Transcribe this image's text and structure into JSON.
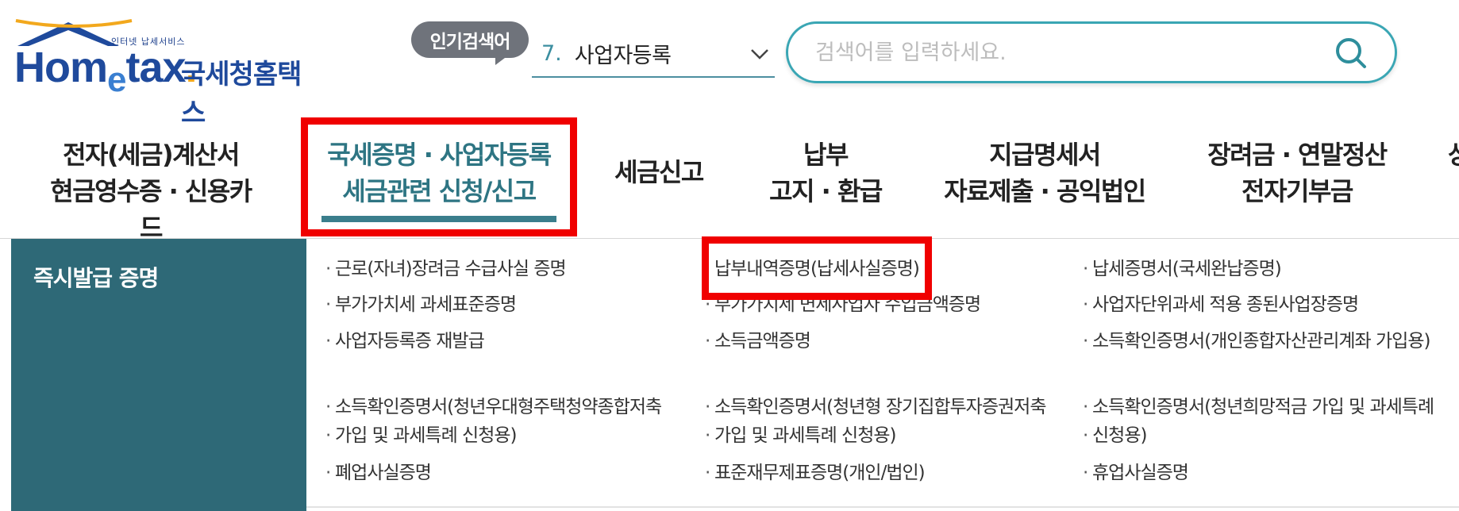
{
  "logo": {
    "tagline": "인터넷 납세서비스",
    "word_pre": "Hom",
    "word_e": "e",
    "word_post": "tax",
    "dot": ".",
    "korean": "국세청홈택스"
  },
  "popular": {
    "badge": "인기검색어",
    "rank": "7.",
    "term": "사업자등록"
  },
  "search": {
    "placeholder": "검색어를 입력하세요."
  },
  "nav": {
    "items": [
      {
        "line1": "전자(세금)계산서",
        "line2": "현금영수증 · 신용카드"
      },
      {
        "line1": "국세증명 · 사업자등록",
        "line2": "세금관련 신청/신고"
      },
      {
        "line1": "세금신고",
        "line2": ""
      },
      {
        "line1": "납부",
        "line2": "고지 · 환급"
      },
      {
        "line1": "지급명세서",
        "line2": "자료제출 · 공익법인"
      },
      {
        "line1": "장려금 · 연말정산",
        "line2": "전자기부금"
      },
      {
        "line1": "상",
        "line2": ""
      }
    ]
  },
  "submenu": {
    "title": "즉시발급 증명",
    "col1": [
      "근로(자녀)장려금 수급사실 증명",
      "부가가치세 과세표준증명",
      "사업자등록증 재발급",
      "소득확인증명서(청년우대형주택청약종합저축",
      "가입 및 과세특례 신청용)",
      "폐업사실증명"
    ],
    "col2": [
      "납부내역증명(납세사실증명)",
      "부가가치세 면세사업자 수입금액증명",
      "소득금액증명",
      "소득확인증명서(청년형 장기집합투자증권저축",
      "가입 및 과세특례 신청용)",
      "표준재무제표증명(개인/법인)"
    ],
    "col3": [
      "납세증명서(국세완납증명)",
      "사업자단위과세 적용 종된사업장증명",
      "소득확인증명서(개인종합자산관리계좌 가입용)",
      "소득확인증명서(청년희망적금 가입 및 과세특례",
      "신청용)",
      "휴업사실증명"
    ]
  },
  "colors": {
    "accent_teal": "#2e6977",
    "active_text": "#2e7583",
    "highlight_red": "#f00000",
    "search_border": "#3aa6b4"
  }
}
